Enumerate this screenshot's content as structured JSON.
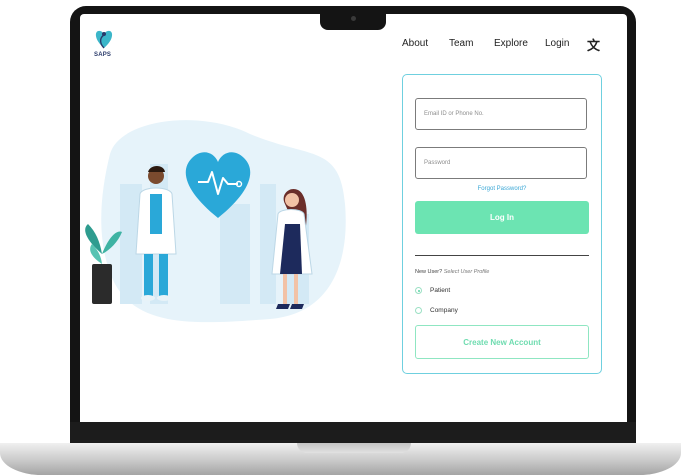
{
  "app": {
    "logo_text": "SAPS"
  },
  "nav": {
    "about": "About",
    "team": "Team",
    "explore": "Explore",
    "login": "Login",
    "translate_icon": "translate-icon"
  },
  "form": {
    "email_placeholder": "Email ID or Phone No.",
    "password_placeholder": "Password",
    "forgot_password": "Forgot Password?",
    "login_button": "Log In",
    "new_user": "New User?",
    "select_profile": "Select User Profile",
    "options": [
      "Patient",
      "Company"
    ],
    "selected_option": "Patient",
    "create_account_button": "Create New Account"
  },
  "colors": {
    "accent_green": "#6ce4b2",
    "card_border": "#6fd0df",
    "heart_blue": "#2aa8d8",
    "link_blue": "#3aa7d6"
  }
}
